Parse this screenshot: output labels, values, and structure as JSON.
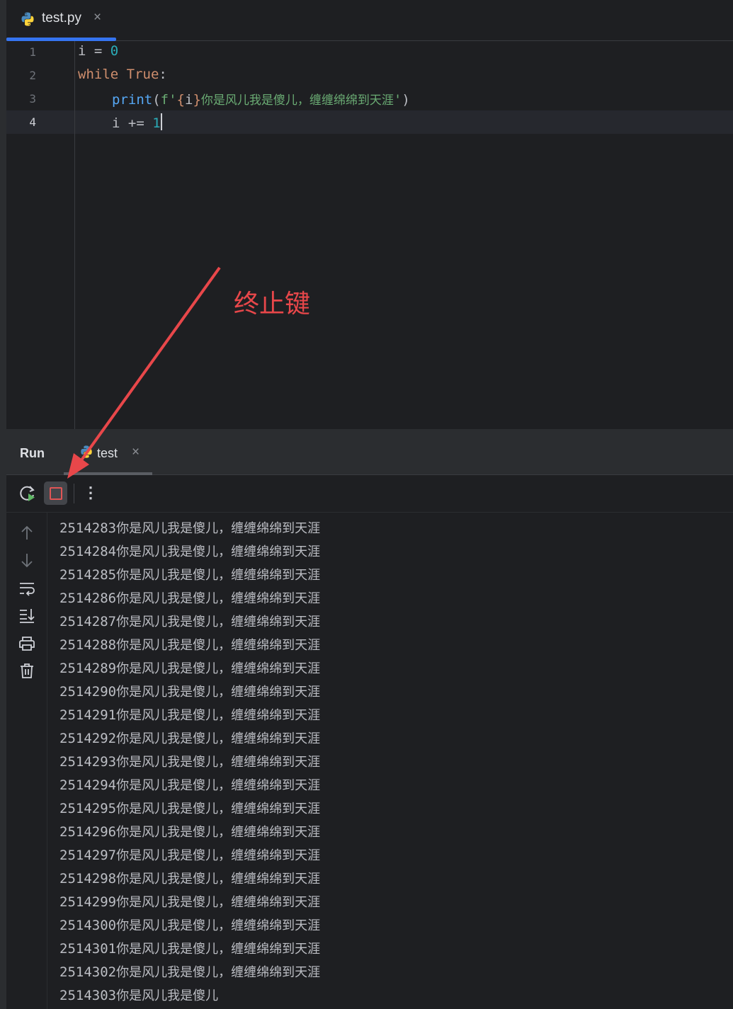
{
  "editor_tab": {
    "label": "test.py",
    "close": "×"
  },
  "gutter": {
    "lines": [
      "1",
      "2",
      "3",
      "4"
    ]
  },
  "code": {
    "line1": {
      "var": "i",
      "op": " = ",
      "num": "0"
    },
    "line2": {
      "kw": "while",
      "kw2": "True",
      "colon": ":"
    },
    "line3": {
      "fn": "print",
      "open": "(",
      "prefix": "f'",
      "lbrace": "{",
      "var": "i",
      "rbrace": "}",
      "text": "你是风儿我是傻儿，缠缠绵绵到天涯",
      "quote": "'",
      "close": ")"
    },
    "line4": {
      "var": "i",
      "op": " += ",
      "num": "1"
    }
  },
  "run_panel": {
    "title": "Run",
    "tab_label": "test",
    "tab_close": "×",
    "more": "⋮"
  },
  "console": {
    "lines": [
      {
        "n": "2514283",
        "t": "你是风儿我是傻儿，缠缠绵绵到天涯"
      },
      {
        "n": "2514284",
        "t": "你是风儿我是傻儿，缠缠绵绵到天涯"
      },
      {
        "n": "2514285",
        "t": "你是风儿我是傻儿，缠缠绵绵到天涯"
      },
      {
        "n": "2514286",
        "t": "你是风儿我是傻儿，缠缠绵绵到天涯"
      },
      {
        "n": "2514287",
        "t": "你是风儿我是傻儿，缠缠绵绵到天涯"
      },
      {
        "n": "2514288",
        "t": "你是风儿我是傻儿，缠缠绵绵到天涯"
      },
      {
        "n": "2514289",
        "t": "你是风儿我是傻儿，缠缠绵绵到天涯"
      },
      {
        "n": "2514290",
        "t": "你是风儿我是傻儿，缠缠绵绵到天涯"
      },
      {
        "n": "2514291",
        "t": "你是风儿我是傻儿，缠缠绵绵到天涯"
      },
      {
        "n": "2514292",
        "t": "你是风儿我是傻儿，缠缠绵绵到天涯"
      },
      {
        "n": "2514293",
        "t": "你是风儿我是傻儿，缠缠绵绵到天涯"
      },
      {
        "n": "2514294",
        "t": "你是风儿我是傻儿，缠缠绵绵到天涯"
      },
      {
        "n": "2514295",
        "t": "你是风儿我是傻儿，缠缠绵绵到天涯"
      },
      {
        "n": "2514296",
        "t": "你是风儿我是傻儿，缠缠绵绵到天涯"
      },
      {
        "n": "2514297",
        "t": "你是风儿我是傻儿，缠缠绵绵到天涯"
      },
      {
        "n": "2514298",
        "t": "你是风儿我是傻儿，缠缠绵绵到天涯"
      },
      {
        "n": "2514299",
        "t": "你是风儿我是傻儿，缠缠绵绵到天涯"
      },
      {
        "n": "2514300",
        "t": "你是风儿我是傻儿，缠缠绵绵到天涯"
      },
      {
        "n": "2514301",
        "t": "你是风儿我是傻儿，缠缠绵绵到天涯"
      },
      {
        "n": "2514302",
        "t": "你是风儿我是傻儿，缠缠绵绵到天涯"
      },
      {
        "n": "2514303",
        "t": "你是风儿我是傻儿"
      }
    ]
  },
  "annotation": {
    "text": "终止键",
    "color": "#e8474a"
  },
  "icons": {
    "editor_tab": "python-icon",
    "run_tab": "python-icon",
    "rerun": "rerun-icon",
    "stop": "stop-icon",
    "side": [
      "arrow-up-icon",
      "arrow-down-icon",
      "soft-wrap-icon",
      "scroll-to-end-icon",
      "print-icon",
      "trash-icon"
    ]
  },
  "colors": {
    "background": "#1e1f22",
    "panel": "#2b2d30",
    "accent": "#3574f0",
    "keyword": "#cf8e6d",
    "number": "#2aacb8",
    "function": "#56a8f5",
    "string": "#6aab73",
    "stop": "#e05555"
  }
}
